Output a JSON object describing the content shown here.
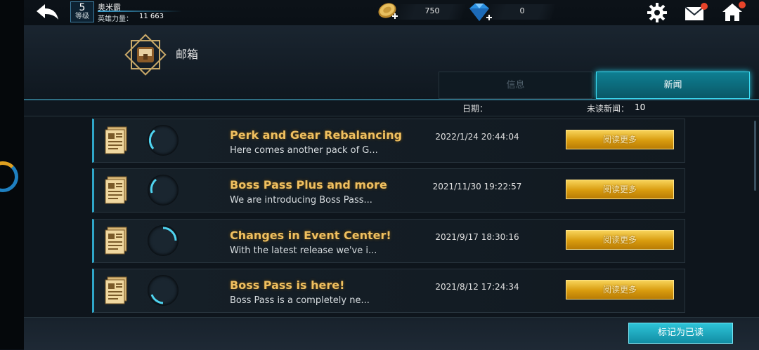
{
  "player": {
    "level": "5",
    "level_label": "等级",
    "name": "奥米霸",
    "power_label": "英雄力量：",
    "power_value": "11 663"
  },
  "currency": {
    "coins": "750",
    "gems": "0"
  },
  "mailbox": {
    "title": "邮箱"
  },
  "tabs": [
    {
      "label": "信息",
      "active": false
    },
    {
      "label": "新闻",
      "active": true
    }
  ],
  "list_header": {
    "date_label": "日期：",
    "unread_label": "未读新闻：",
    "unread_count": "10"
  },
  "news": [
    {
      "title": "Perk and Gear Rebalancing",
      "preview": "Here comes another pack of G...",
      "date": "2022/1/24 20:44:04",
      "button": "阅读更多"
    },
    {
      "title": "Boss Pass Plus and more",
      "preview": "We are introducing Boss Pass...",
      "date": "2021/11/30 19:22:57",
      "button": "阅读更多"
    },
    {
      "title": "Changes in Event Center!",
      "preview": "With the latest release we've i...",
      "date": "2021/9/17 18:30:16",
      "button": "阅读更多"
    },
    {
      "title": "Boss Pass is here!",
      "preview": "Boss Pass is a completely ne...",
      "date": "2021/8/12 17:24:34",
      "button": "阅读更多"
    }
  ],
  "footer": {
    "mark_read_label": "标记为已读"
  },
  "colors": {
    "accent_cyan": "#22c8e0",
    "gold_button": "#e0a91a",
    "title_gold": "#f0c060"
  },
  "icons": [
    "back-arrow-icon",
    "coin-icon",
    "gem-icon",
    "plus-icon",
    "gear-icon",
    "mail-icon",
    "home-icon",
    "mailbox-icon",
    "newspaper-icon"
  ]
}
